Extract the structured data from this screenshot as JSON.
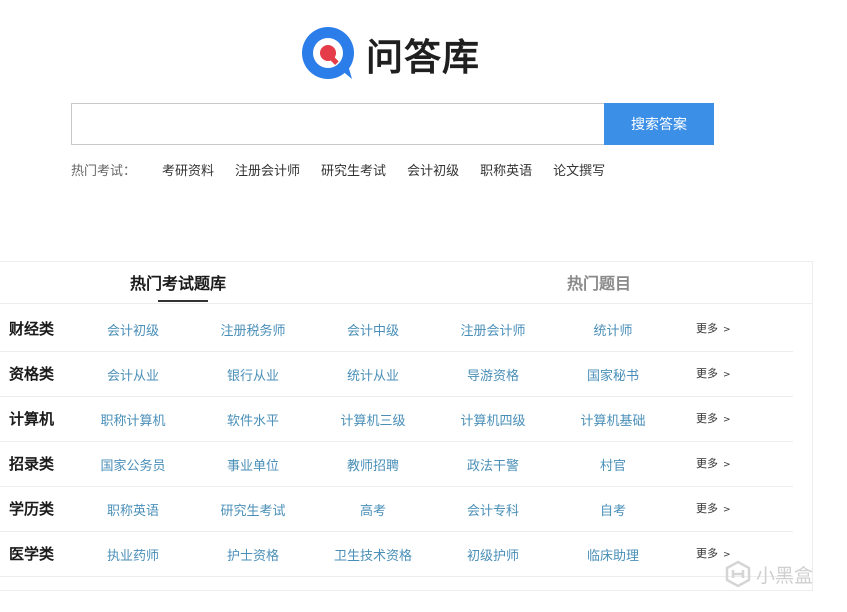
{
  "logo": {
    "text": "问答库",
    "icon": "q-chat-bubble-icon",
    "colors": {
      "blue": "#2b7de9",
      "red": "#e53c4a"
    }
  },
  "search": {
    "value": "",
    "placeholder": "",
    "button_label": "搜索答案",
    "button_color": "#3c8fe6"
  },
  "hot_exams": {
    "label": "热门考试：",
    "items": [
      "考研资料",
      "注册会计师",
      "研究生考试",
      "会计初级",
      "职称英语",
      "论文撰写"
    ]
  },
  "tabs": [
    {
      "label": "热门考试题库",
      "active": true
    },
    {
      "label": "热门题目",
      "active": false
    }
  ],
  "more_label": "更多",
  "rows": [
    {
      "category": "财经类",
      "links": [
        "会计初级",
        "注册税务师",
        "会计中级",
        "注册会计师",
        "统计师"
      ]
    },
    {
      "category": "资格类",
      "links": [
        "会计从业",
        "银行从业",
        "统计从业",
        "导游资格",
        "国家秘书"
      ]
    },
    {
      "category": "计算机",
      "links": [
        "职称计算机",
        "软件水平",
        "计算机三级",
        "计算机四级",
        "计算机基础"
      ]
    },
    {
      "category": "招录类",
      "links": [
        "国家公务员",
        "事业单位",
        "教师招聘",
        "政法干警",
        "村官"
      ]
    },
    {
      "category": "学历类",
      "links": [
        "职称英语",
        "研究生考试",
        "高考",
        "会计专科",
        "自考"
      ]
    },
    {
      "category": "医学类",
      "links": [
        "执业药师",
        "护士资格",
        "卫生技术资格",
        "初级护师",
        "临床助理"
      ]
    }
  ],
  "watermark": {
    "text": "小黑盒",
    "icon": "heybox-logo-icon"
  },
  "link_color": "#4a8fb8"
}
